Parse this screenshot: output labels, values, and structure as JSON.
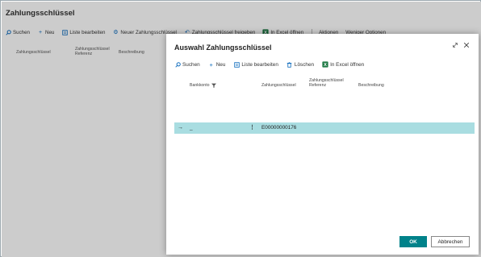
{
  "background": {
    "title": "Zahlungsschlüssel",
    "toolbar": [
      {
        "label": "Suchen",
        "icon": "search-icon"
      },
      {
        "label": "Neu",
        "icon": "plus-icon"
      },
      {
        "label": "Liste bearbeiten",
        "icon": "edit-list-icon"
      },
      {
        "label": "Neuer Zahlungsschlüssel",
        "icon": "gear-icon"
      },
      {
        "label": "Zahlungsschlüssel freigeben",
        "icon": "undo-icon"
      },
      {
        "label": "In Excel öffnen",
        "icon": "excel-icon"
      },
      {
        "label": "Aktionen",
        "icon": ""
      },
      {
        "label": "Weniger Optionen",
        "icon": ""
      }
    ],
    "columns": [
      "Zahlungsschlüssel",
      "Zahlungsschlüssel Referenz",
      "Beschreibung"
    ]
  },
  "dialog": {
    "title": "Auswahl Zahlungsschlüssel",
    "toolbar": [
      {
        "label": "Suchen",
        "icon": "search-icon"
      },
      {
        "label": "Neu",
        "icon": "plus-icon"
      },
      {
        "label": "Liste bearbeiten",
        "icon": "edit-list-icon"
      },
      {
        "label": "Löschen",
        "icon": "trash-icon"
      },
      {
        "label": "In Excel öffnen",
        "icon": "excel-icon"
      }
    ],
    "columns": {
      "bankkonto": "Bankkonto",
      "zahlungsschluessel": "Zahlungsschlüssel",
      "referenz_line1": "Zahlungsschlüssel",
      "referenz_line2": "Referenz",
      "beschreibung": "Beschreibung"
    },
    "rows": [
      {
        "bankkonto": "_",
        "zahlungsschluessel": "E00000000176",
        "referenz": "",
        "beschreibung": ""
      }
    ],
    "ok_label": "OK",
    "cancel_label": "Abbrechen"
  },
  "colors": {
    "accent": "#00828a",
    "row_selected": "#a9dde1",
    "icon_blue": "#0f6cbd"
  }
}
